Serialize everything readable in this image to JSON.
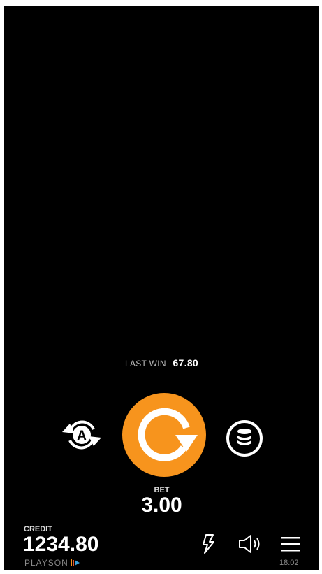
{
  "last_win": {
    "label": "LAST WIN",
    "value": "67.80"
  },
  "bet": {
    "label": "BET",
    "value": "3.00"
  },
  "credit": {
    "label": "CREDIT",
    "value": "1234.80"
  },
  "brand": {
    "name": "PLAYSON"
  },
  "status": {
    "time": "18:02"
  },
  "icons": {
    "autoplay": "autoplay-icon",
    "spin": "spin-icon",
    "coins": "coins-icon",
    "turbo": "lightning-icon",
    "sound": "speaker-icon",
    "menu": "hamburger-menu-icon"
  },
  "colors": {
    "accent": "#f7941d",
    "background": "#000000"
  }
}
